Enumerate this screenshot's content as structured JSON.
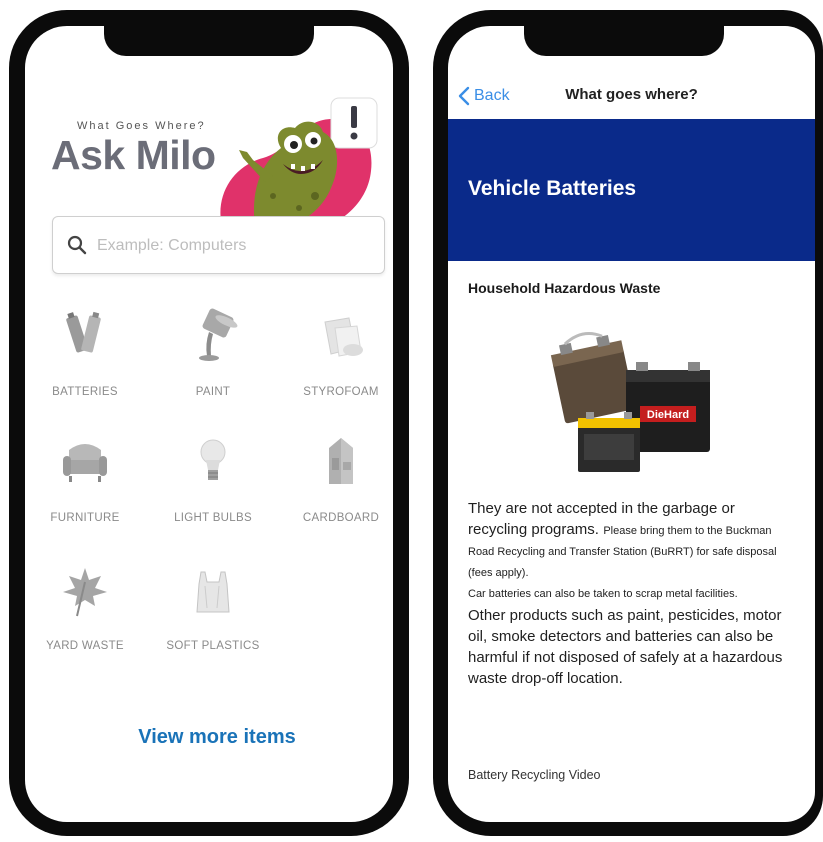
{
  "left_screen": {
    "hero": {
      "tagline": "What Goes Where?",
      "title": "Ask Milo"
    },
    "search": {
      "placeholder": "Example: Computers",
      "icon": "search-icon"
    },
    "categories": [
      {
        "label": "BATTERIES",
        "icon": "batteries-icon"
      },
      {
        "label": "PAINT",
        "icon": "paint-icon"
      },
      {
        "label": "STYROFOAM",
        "icon": "styrofoam-icon"
      },
      {
        "label": "FURNITURE",
        "icon": "furniture-icon"
      },
      {
        "label": "LIGHT BULBS",
        "icon": "light-bulb-icon"
      },
      {
        "label": "CARDBOARD",
        "icon": "cardboard-icon"
      },
      {
        "label": "YARD WASTE",
        "icon": "leaf-icon"
      },
      {
        "label": "SOFT PLASTICS",
        "icon": "plastic-bag-icon"
      }
    ],
    "view_more_label": "View more items"
  },
  "right_screen": {
    "nav": {
      "back_label": "Back",
      "title": "What goes where?"
    },
    "banner_title": "Vehicle Batteries",
    "section_heading": "Household Hazardous Waste",
    "battery_label": "DieHard",
    "body": {
      "line1": "They are not accepted in the garbage or recycling programs.",
      "line2": "Please bring them to the Buckman Road Recycling and Transfer Station (BuRRT) for safe disposal (fees apply).",
      "line3": "Car batteries can also be taken to scrap metal facilities.",
      "line4": "Other products such as paint, pesticides, motor oil, smoke detectors and batteries can also be harmful if not disposed of safely at a hazardous waste drop-off location."
    },
    "video_link": "Battery Recycling Video"
  },
  "colors": {
    "banner": "#0a2a8a",
    "link": "#1a73b8",
    "back": "#3a8ee6",
    "monster_green": "#7d8a2e",
    "hero_pink": "#e0326a"
  }
}
